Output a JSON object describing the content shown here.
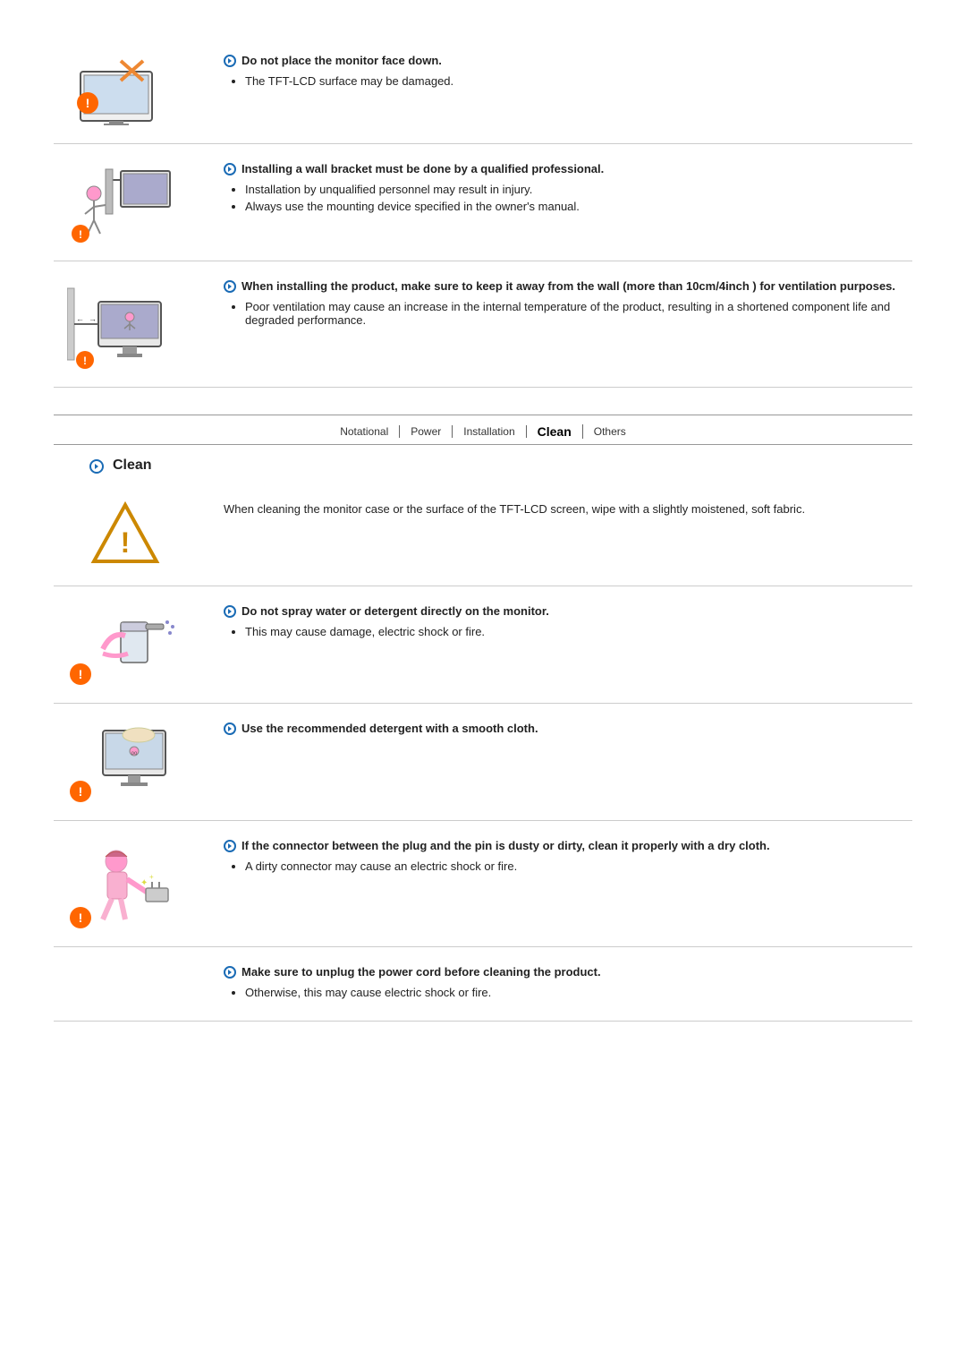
{
  "nav": {
    "items": [
      {
        "label": "Notational",
        "active": false
      },
      {
        "label": "Power",
        "active": false
      },
      {
        "label": "Installation",
        "active": false
      },
      {
        "label": "Clean",
        "active": true
      },
      {
        "label": "Others",
        "active": false
      }
    ]
  },
  "sections_installation": [
    {
      "id": "face-down",
      "heading": "Do not place the monitor face down.",
      "bullets": [
        "The TFT-LCD surface may be damaged."
      ]
    },
    {
      "id": "wall-bracket",
      "heading": "Installing a wall bracket must be done by a qualified professional.",
      "bullets": [
        "Installation by unqualified personnel may result in injury.",
        "Always use the mounting device specified in the owner's manual."
      ]
    },
    {
      "id": "ventilation",
      "heading": "When installing the product, make sure to keep it away from the wall (more than 10cm/4inch ) for ventilation purposes.",
      "bullets": [
        "Poor ventilation may cause an increase in the internal temperature of the product, resulting in a shortened component life and degraded performance."
      ]
    }
  ],
  "clean_section": {
    "title": "Clean",
    "caution_text": "When cleaning the monitor case or the surface of the TFT-LCD screen, wipe with a slightly moistened, soft fabric.",
    "items": [
      {
        "id": "no-spray",
        "heading": "Do not spray water or detergent directly on the monitor.",
        "bullets": [
          "This may cause damage, electric shock or fire."
        ]
      },
      {
        "id": "detergent",
        "heading": "Use the recommended detergent with a smooth cloth.",
        "bullets": []
      },
      {
        "id": "connector",
        "heading": "If the connector between the plug and the pin is dusty or dirty, clean it properly with a dry cloth.",
        "bullets": [
          "A dirty connector may cause an electric shock or fire."
        ]
      },
      {
        "id": "unplug",
        "heading": "Make sure to unplug the power cord before cleaning the product.",
        "bullets": [
          "Otherwise, this may cause electric shock or fire."
        ]
      }
    ]
  }
}
